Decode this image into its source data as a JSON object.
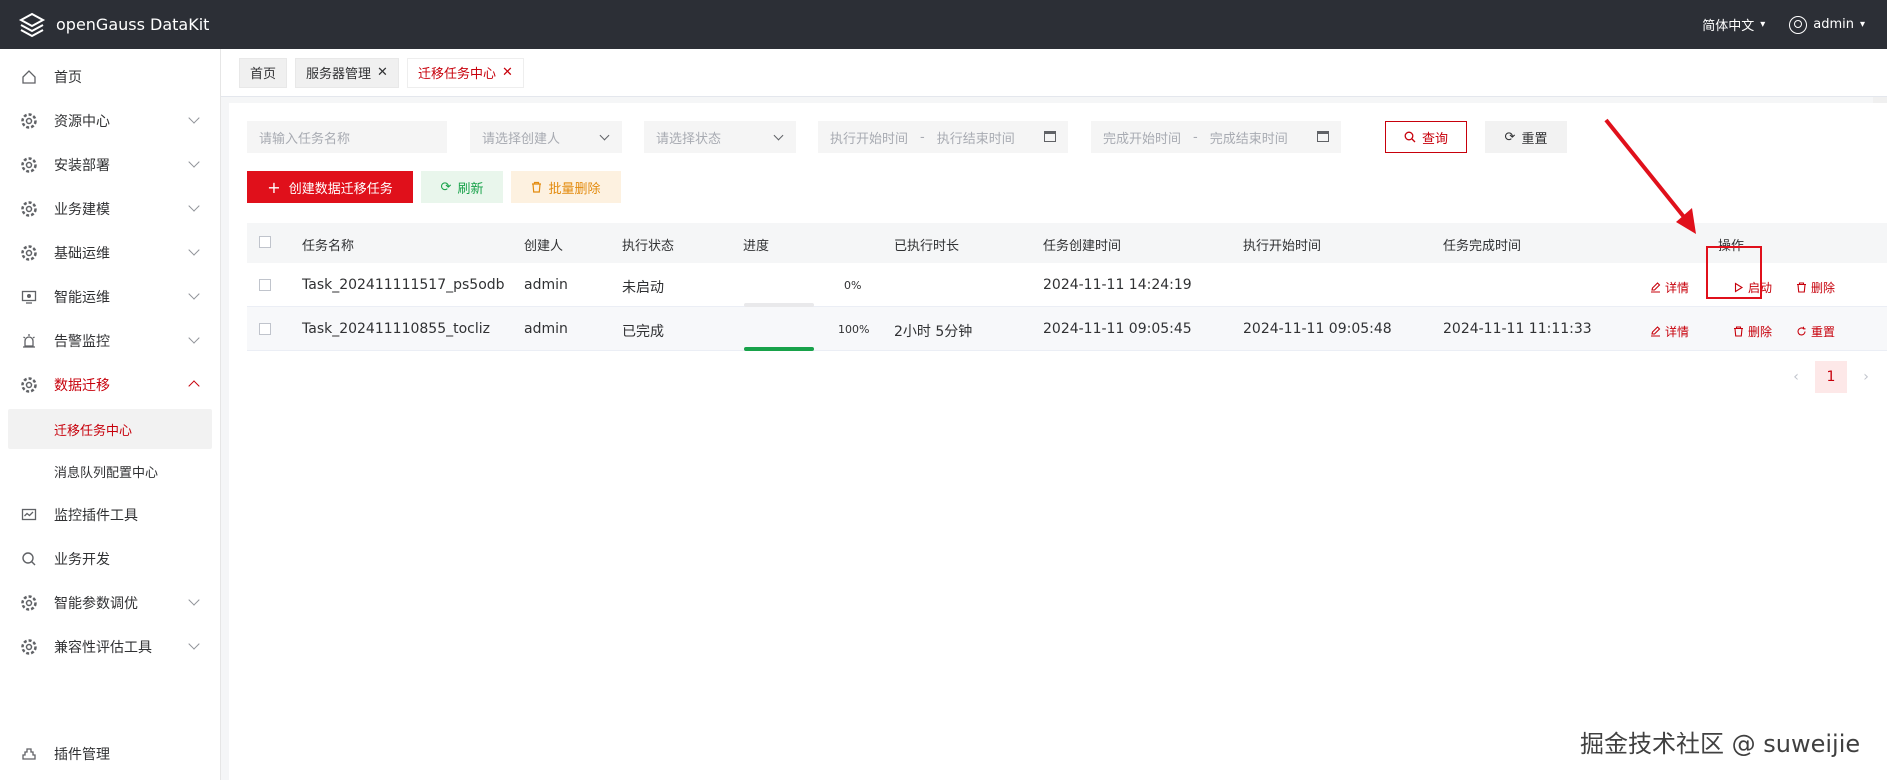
{
  "app": {
    "title": "openGauss DataKit"
  },
  "topbar": {
    "language": "简体中文",
    "user": "admin"
  },
  "sidebar": {
    "items": [
      {
        "label": "首页",
        "icon": "home-icon",
        "expandable": false
      },
      {
        "label": "资源中心",
        "icon": "gear-icon",
        "expandable": true
      },
      {
        "label": "安装部署",
        "icon": "gear-icon",
        "expandable": true
      },
      {
        "label": "业务建模",
        "icon": "gear-icon",
        "expandable": true
      },
      {
        "label": "基础运维",
        "icon": "gear-icon",
        "expandable": true
      },
      {
        "label": "智能运维",
        "icon": "monitor-icon",
        "expandable": true
      },
      {
        "label": "告警监控",
        "icon": "alarm-icon",
        "expandable": true
      },
      {
        "label": "数据迁移",
        "icon": "gear-icon",
        "expandable": true,
        "expanded": true
      },
      {
        "label": "监控插件工具",
        "icon": "chart-monitor-icon",
        "expandable": false
      },
      {
        "label": "业务开发",
        "icon": "search-icon",
        "expandable": false
      },
      {
        "label": "智能参数调优",
        "icon": "gear-icon",
        "expandable": true
      },
      {
        "label": "兼容性评估工具",
        "icon": "gear-icon",
        "expandable": true
      }
    ],
    "sub_items": [
      {
        "label": "迁移任务中心",
        "active": true
      },
      {
        "label": "消息队列配置中心",
        "active": false
      }
    ],
    "bottom": {
      "label": "插件管理",
      "icon": "plugin-icon"
    }
  },
  "tabs": [
    {
      "label": "首页",
      "closable": false,
      "active": false
    },
    {
      "label": "服务器管理",
      "closable": true,
      "active": false
    },
    {
      "label": "迁移任务中心",
      "closable": true,
      "active": true
    }
  ],
  "filters": {
    "task_name_placeholder": "请输入任务名称",
    "creator_placeholder": "请选择创建人",
    "status_placeholder": "请选择状态",
    "exec_start_placeholder": "执行开始时间",
    "exec_end_placeholder": "执行结束时间",
    "finish_start_placeholder": "完成开始时间",
    "finish_end_placeholder": "完成结束时间",
    "range_separator": "-",
    "query_label": "查询",
    "reset_label": "重置"
  },
  "actions": {
    "create_label": "创建数据迁移任务",
    "refresh_label": "刷新",
    "batch_delete_label": "批量删除"
  },
  "table": {
    "headers": {
      "name": "任务名称",
      "creator": "创建人",
      "status": "执行状态",
      "progress": "进度",
      "duration": "已执行时长",
      "created": "任务创建时间",
      "exec_start": "执行开始时间",
      "finished": "任务完成时间",
      "ops": "操作"
    },
    "rows": [
      {
        "name": "Task_202411111517_ps5odb",
        "creator": "admin",
        "status": "未启动",
        "progress": 0,
        "progress_label": "0%",
        "duration": "",
        "created": "2024-11-11 14:24:19",
        "exec_start": "",
        "finished": "",
        "ops": [
          "详情",
          "启动",
          "删除"
        ]
      },
      {
        "name": "Task_202411110855_tocliz",
        "creator": "admin",
        "status": "已完成",
        "progress": 100,
        "progress_label": "100%",
        "duration": "2小时 5分钟",
        "created": "2024-11-11 09:05:45",
        "exec_start": "2024-11-11 09:05:48",
        "finished": "2024-11-11 11:11:33",
        "ops": [
          "详情",
          "删除",
          "重置"
        ]
      }
    ]
  },
  "pagination": {
    "current": "1",
    "prev": "‹",
    "next": "›"
  },
  "watermark": "掘金技术社区 @ suweijie",
  "colors": {
    "brand_red": "#c7000b",
    "success_green": "#18a24a",
    "topbar": "#2c2f36"
  }
}
